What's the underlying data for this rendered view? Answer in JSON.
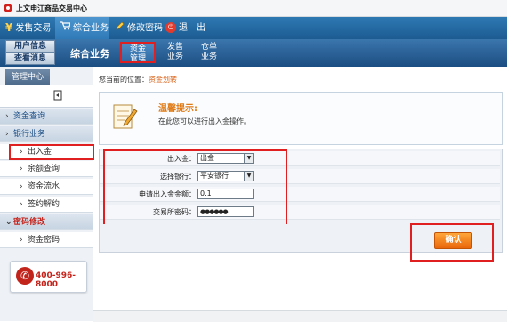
{
  "app": {
    "title": "上文申江商品交易中心"
  },
  "topnav": {
    "items": [
      {
        "label": "发售交易"
      },
      {
        "label": "综合业务"
      },
      {
        "label": "修改密码"
      },
      {
        "label": "退　出"
      }
    ]
  },
  "user": {
    "info_label": "用户信息",
    "msg_label": "查看消息"
  },
  "section_title": "综合业务",
  "subtabs": [
    {
      "line1": "资金",
      "line2": "管理"
    },
    {
      "line1": "发售",
      "line2": "业务"
    },
    {
      "line1": "仓单",
      "line2": "业务"
    }
  ],
  "sidebar": {
    "header": "管理中心",
    "items": [
      {
        "label": "资金查询"
      },
      {
        "label": "银行业务"
      },
      {
        "label": "出入金"
      },
      {
        "label": "余额查询"
      },
      {
        "label": "资金流水"
      },
      {
        "label": "签约解约"
      },
      {
        "label": "密码修改"
      },
      {
        "label": "资金密码"
      }
    ],
    "phone": "400-996-8000"
  },
  "breadcrumb": {
    "prefix": "您当前的位置：",
    "current": "资金划转"
  },
  "tip": {
    "title": "温馨提示:",
    "text": "在此您可以进行出入金操作。"
  },
  "form": {
    "fields": [
      {
        "label": "出入金：",
        "value": "出金"
      },
      {
        "label": "选择银行：",
        "value": "平安银行"
      },
      {
        "label": "申请出入金金额：",
        "value": "0.1"
      },
      {
        "label": "交易所密码：",
        "value": "●●●●●●"
      }
    ],
    "confirm_label": "确认"
  },
  "colors": {
    "nav": "#1c5b92",
    "highlight": "#e02020",
    "accent": "#e9660a"
  }
}
